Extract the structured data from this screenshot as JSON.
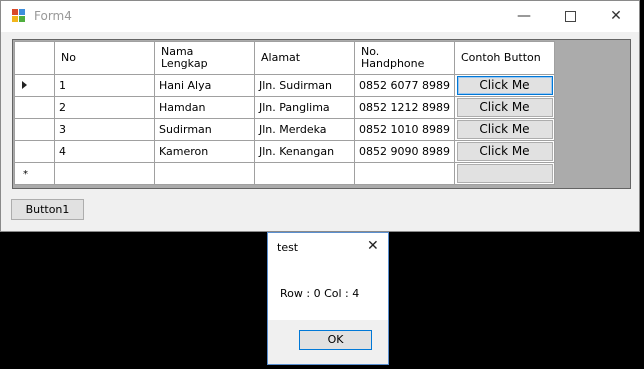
{
  "window": {
    "title": "Form4",
    "minimize_glyph": "—",
    "close_glyph": "✕"
  },
  "grid": {
    "columns": [
      {
        "line1": "No",
        "line2": ""
      },
      {
        "line1": "Nama",
        "line2": "Lengkap"
      },
      {
        "line1": "Alamat",
        "line2": ""
      },
      {
        "line1": "No.",
        "line2": "Handphone"
      },
      {
        "line1": "Contoh Button",
        "line2": ""
      }
    ],
    "rows": [
      {
        "no": "1",
        "nama": "Hani Alya",
        "alamat": "Jln. Sudirman",
        "hp": "0852 6077 8989",
        "button": "Click Me"
      },
      {
        "no": "2",
        "nama": "Hamdan",
        "alamat": "Jln. Panglima",
        "hp": "0852 1212 8989",
        "button": "Click Me"
      },
      {
        "no": "3",
        "nama": "Sudirman",
        "alamat": "Jln. Merdeka",
        "hp": "0852 1010 8989",
        "button": "Click Me"
      },
      {
        "no": "4",
        "nama": "Kameron",
        "alamat": "Jln. Kenangan",
        "hp": "0852 9090 8989",
        "button": "Click Me"
      }
    ],
    "new_row_glyph": "*"
  },
  "button1_label": "Button1",
  "dialog": {
    "title": "test",
    "close_glyph": "✕",
    "message": "Row : 0  Col : 4",
    "ok_label": "OK"
  }
}
